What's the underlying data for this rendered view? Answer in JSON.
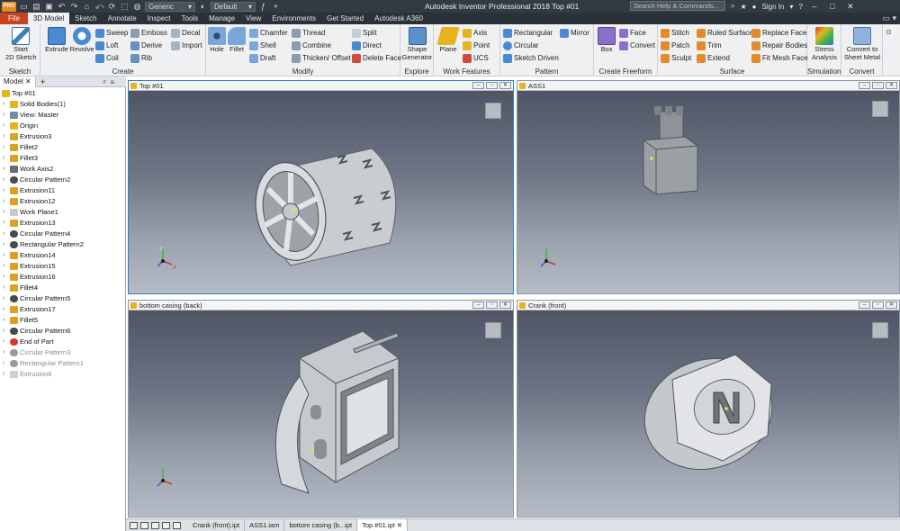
{
  "app": {
    "title": "Autodesk Inventor Professional 2018    Top #01",
    "appearance_combo": "Generic",
    "material_combo": "Default",
    "search_placeholder": "Search Help & Commands...",
    "sign_in": "Sign In",
    "accent": "#c7421f"
  },
  "ribbon_tabs": [
    "File",
    "3D Model",
    "Sketch",
    "Annotate",
    "Inspect",
    "Tools",
    "Manage",
    "View",
    "Environments",
    "Get Started",
    "Autodesk A360"
  ],
  "ribbon": {
    "sketch": {
      "title": "Sketch",
      "start_sketch": "Start\n2D Sketch"
    },
    "create": {
      "title": "Create",
      "extrude": "Extrude",
      "revolve": "Revolve",
      "sweep": "Sweep",
      "loft": "Loft",
      "coil": "Coil",
      "emboss": "Emboss",
      "derive": "Derive",
      "rib": "Rib",
      "decal": "Decal",
      "import": "Import"
    },
    "modify": {
      "title": "Modify",
      "hole": "Hole",
      "fillet": "Fillet",
      "chamfer": "Chamfer",
      "shell": "Shell",
      "draft": "Draft",
      "thread": "Thread",
      "combine": "Combine",
      "thicken": "Thicken/ Offset",
      "split": "Split",
      "direct": "Direct",
      "delete_face": "Delete Face"
    },
    "explore": {
      "title": "Explore",
      "shape_generator": "Shape\nGenerator"
    },
    "work_features": {
      "title": "Work Features",
      "plane": "Plane",
      "axis": "Axis",
      "point": "Point",
      "ucs": "UCS"
    },
    "pattern": {
      "title": "Pattern",
      "rectangular": "Rectangular",
      "circular": "Circular",
      "sketch_driven": "Sketch Driven",
      "mirror": "Mirror"
    },
    "freeform": {
      "title": "Create Freeform",
      "box": "Box",
      "face": "Face",
      "convert": "Convert"
    },
    "surface": {
      "title": "Surface",
      "stitch": "Stitch",
      "patch": "Patch",
      "sculpt": "Sculpt",
      "ruled_surface": "Ruled Surface",
      "trim": "Trim",
      "extend": "Extend",
      "replace_face": "Replace Face",
      "repair_bodies": "Repair Bodies",
      "fit_mesh_face": "Fit Mesh Face"
    },
    "simulation": {
      "title": "Simulation",
      "stress_analysis": "Stress\nAnalysis"
    },
    "convert": {
      "title": "Convert",
      "convert_to_sheet_metal": "Convert to\nSheet Metal"
    }
  },
  "browser": {
    "tab": "Model",
    "root": "Top #01",
    "nodes": [
      {
        "label": "Solid Bodies(1)",
        "icon": "folder",
        "color": "#e8b41e"
      },
      {
        "label": "View: Master",
        "icon": "eye",
        "color": "#7a8aa0"
      },
      {
        "label": "Origin",
        "icon": "folder",
        "color": "#e8b41e"
      },
      {
        "label": "Extrusion3",
        "icon": "extrusion",
        "color": "#d9a320"
      },
      {
        "label": "Fillet2",
        "icon": "fillet",
        "color": "#d9a320"
      },
      {
        "label": "Fillet3",
        "icon": "fillet",
        "color": "#d9a320"
      },
      {
        "label": "Work Axis2",
        "icon": "axis",
        "color": "#6b6b6b"
      },
      {
        "label": "Circular Pattern2",
        "icon": "pattern",
        "color": "#4a4a4a"
      },
      {
        "label": "Extrusion11",
        "icon": "extrusion",
        "color": "#d9a320"
      },
      {
        "label": "Extrusion12",
        "icon": "extrusion",
        "color": "#d9a320"
      },
      {
        "label": "Work Plane1",
        "icon": "plane",
        "color": "#c9c9c9"
      },
      {
        "label": "Extrusion13",
        "icon": "extrusion",
        "color": "#d9a320"
      },
      {
        "label": "Circular Pattern4",
        "icon": "pattern",
        "color": "#4a4a4a"
      },
      {
        "label": "Rectangular Pattern2",
        "icon": "pattern",
        "color": "#4a4a4a"
      },
      {
        "label": "Extrusion14",
        "icon": "extrusion",
        "color": "#d9a320"
      },
      {
        "label": "Extrusion15",
        "icon": "extrusion",
        "color": "#d9a320"
      },
      {
        "label": "Extrusion16",
        "icon": "extrusion",
        "color": "#d9a320"
      },
      {
        "label": "Fillet4",
        "icon": "fillet",
        "color": "#d9a320"
      },
      {
        "label": "Circular Pattern5",
        "icon": "pattern",
        "color": "#4a4a4a"
      },
      {
        "label": "Extrusion17",
        "icon": "extrusion",
        "color": "#d9a320"
      },
      {
        "label": "Fillet5",
        "icon": "fillet",
        "color": "#d9a320"
      },
      {
        "label": "Circular Pattern6",
        "icon": "pattern",
        "color": "#4a4a4a"
      },
      {
        "label": "End of Part",
        "icon": "end",
        "color": "#d23a2a"
      },
      {
        "label": "Circular Pattern3",
        "icon": "pattern",
        "color": "#9a9a9a",
        "suppressed": true
      },
      {
        "label": "Rectangular Pattern1",
        "icon": "pattern",
        "color": "#9a9a9a",
        "suppressed": true
      },
      {
        "label": "Extrusion6",
        "icon": "extrusion",
        "color": "#cfcfcf",
        "suppressed": true
      }
    ]
  },
  "viewports": [
    {
      "title": "Top #01",
      "model": "drum",
      "active": true
    },
    {
      "title": "ASS1",
      "model": "assembly"
    },
    {
      "title": "bottom casing (back)",
      "model": "casing"
    },
    {
      "title": "Crank (front)",
      "model": "crank"
    }
  ],
  "document_tabs": [
    "Crank (front).ipt",
    "ASS1.iam",
    "bottom casing (b...ipt",
    "Top #01.ipt"
  ],
  "active_document": "Top #01.ipt"
}
